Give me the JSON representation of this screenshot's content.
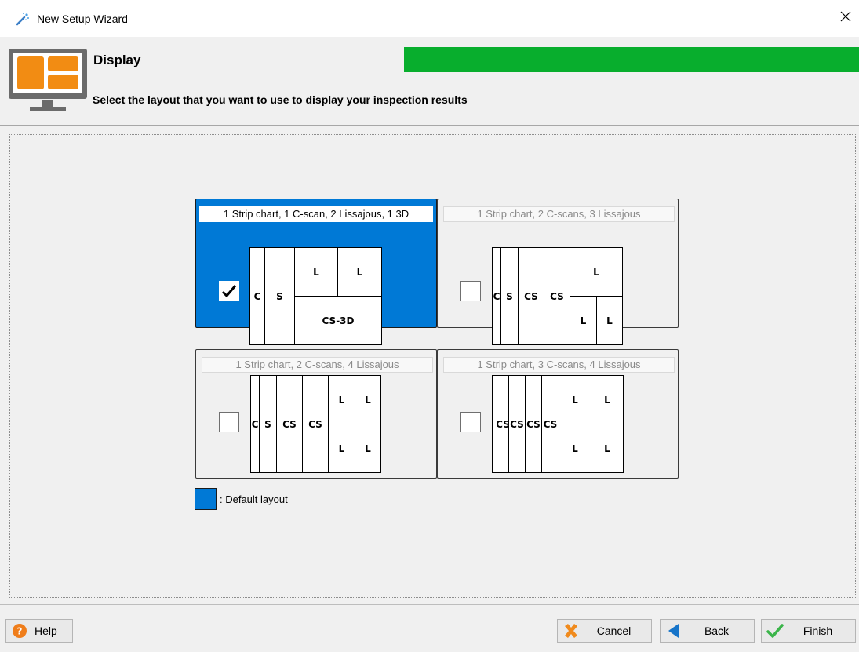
{
  "window": {
    "title": "New Setup Wizard"
  },
  "header": {
    "title": "Display",
    "description": "Select the layout that you want to use to display your inspection results",
    "progress": 1.0,
    "progress_color": "#08ae2d"
  },
  "layouts": [
    {
      "caption": "1 Strip chart, 1 C-scan, 2 Lissajous, 1 3D",
      "checked": true,
      "default": true,
      "panes": [
        "C",
        "S",
        "L",
        "L",
        "CS-3D"
      ]
    },
    {
      "caption": "1 Strip chart, 2 C-scans, 3 Lissajous",
      "checked": false,
      "default": false,
      "panes": [
        "C",
        "S",
        "CS",
        "CS",
        "L",
        "L",
        "L"
      ]
    },
    {
      "caption": "1 Strip chart, 2 C-scans, 4 Lissajous",
      "checked": false,
      "default": false,
      "panes": [
        "C",
        "S",
        "CS",
        "CS",
        "L",
        "L",
        "L",
        "L"
      ]
    },
    {
      "caption": "1 Strip chart, 3 C-scans, 4 Lissajous",
      "checked": false,
      "default": false,
      "panes": [
        "CS",
        "CS",
        "CS",
        "CS",
        "L",
        "L",
        "L",
        "L"
      ]
    }
  ],
  "legend": {
    "label": ": Default layout",
    "color": "#0079d6"
  },
  "buttons": {
    "help": "Help",
    "cancel": "Cancel",
    "back": "Back",
    "finish": "Finish"
  },
  "icons": {
    "window": "magic-wand-icon",
    "header": "monitor-layout-icon",
    "close": "close-icon",
    "help": "question-circle-icon",
    "cancel": "x-icon",
    "back": "arrow-left-icon",
    "finish": "checkmark-icon"
  }
}
